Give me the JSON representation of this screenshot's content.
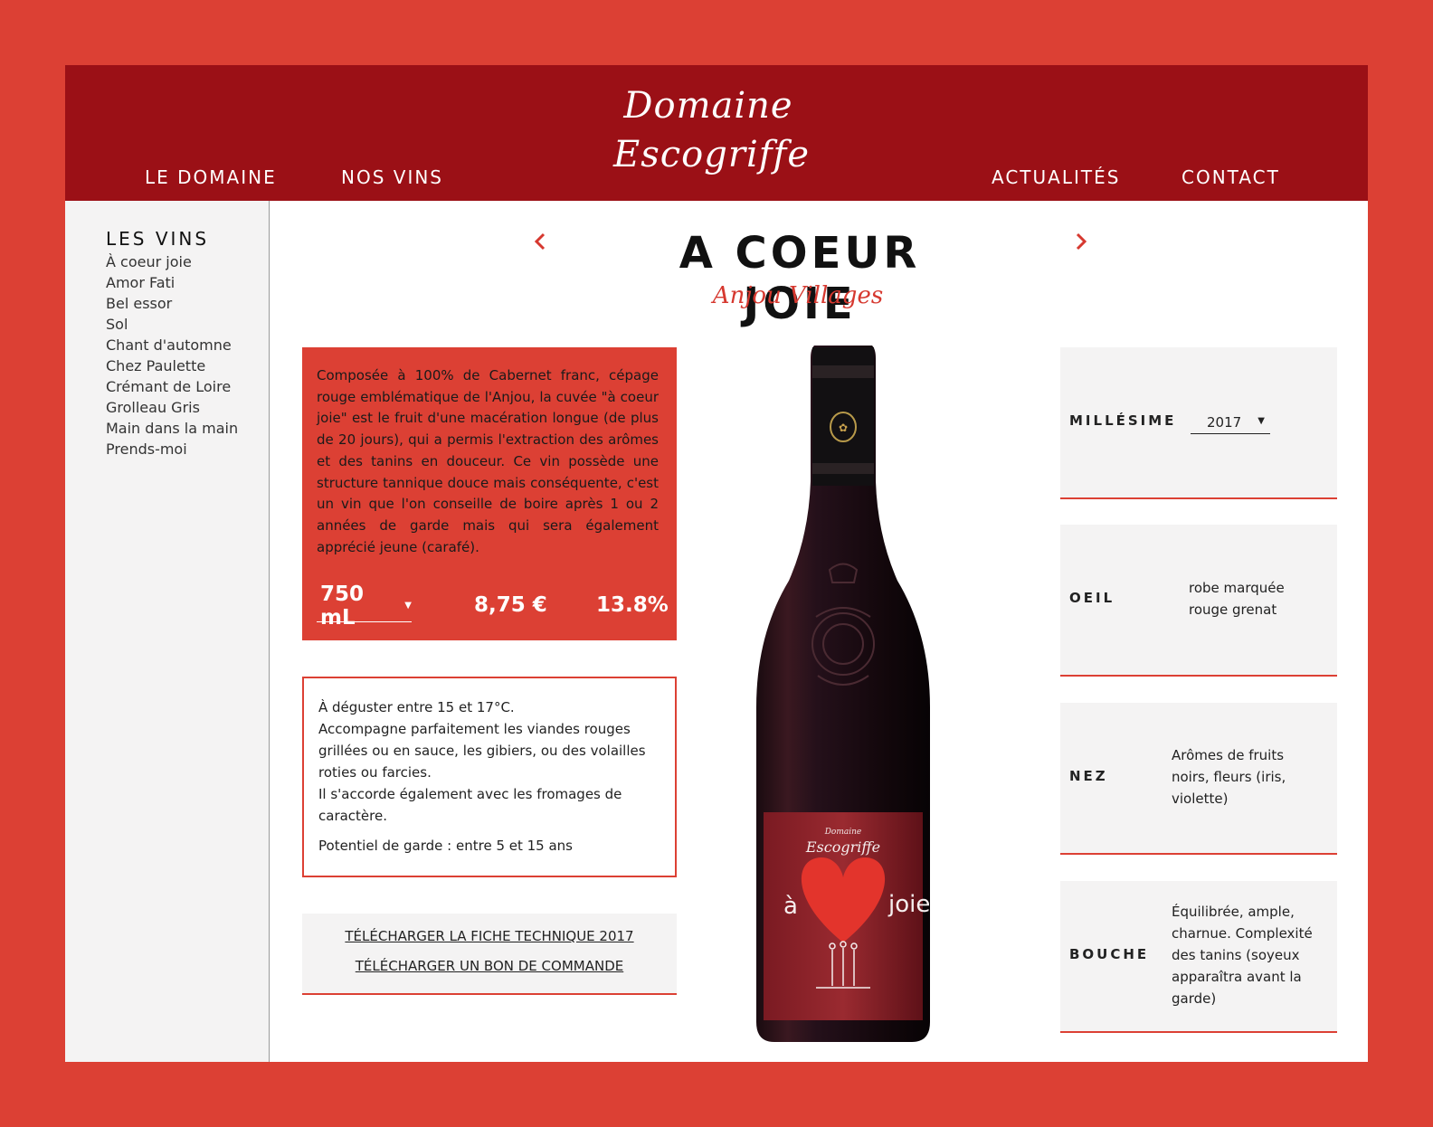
{
  "header": {
    "brand_line1": "Domaine",
    "brand_line2": "Escogriffe",
    "nav": [
      "LE DOMAINE",
      "NOS VINS",
      "ACTUALITÉS",
      "CONTACT"
    ]
  },
  "sidebar": {
    "title": "LES VINS",
    "items": [
      "À coeur joie",
      "Amor Fati",
      "Bel essor",
      "Sol",
      "Chant d'automne",
      "Chez Paulette",
      "Crémant de Loire",
      "Grolleau Gris",
      "Main dans la main",
      "Prends-moi"
    ]
  },
  "wine": {
    "name": "A COEUR JOIE",
    "appellation": "Anjou Villages",
    "description": "Composée à 100% de Cabernet franc, cépage rouge emblématique de l'Anjou, la cuvée \"à coeur joie\" est le fruit d'une macération longue (de plus de 20 jours), qui a permis l'extraction des arômes et des tanins en douceur. Ce vin possède une structure tannique douce mais conséquente, c'est un vin que l'on conseille de boire après 1 ou 2 années de garde mais qui sera également apprécié jeune (carafé).",
    "format": "750 mL",
    "price": "8,75 €",
    "alcohol": "13.8%"
  },
  "serving": {
    "lines": [
      "À déguster entre 15 et 17°C.",
      "Accompagne parfaitement les viandes rouges grillées ou en sauce, les gibiers, ou des volailles roties ou farcies.",
      "Il s'accorde également avec les fromages de caractère."
    ],
    "guard": "Potentiel de garde : entre 5 et 15 ans"
  },
  "downloads": {
    "technical_sheet": "TÉLÉCHARGER LA FICHE TECHNIQUE 2017",
    "order_form": "TÉLÉCHARGER UN BON DE COMMANDE"
  },
  "label": {
    "brand_small": "Domaine",
    "brand": "Escogriffe",
    "word_left": "à",
    "word_right": "joie"
  },
  "cards": {
    "vintage_label": "MILLÉSIME",
    "vintage_value": "2017",
    "eye_label": "OEIL",
    "eye_value_1": "robe marquée",
    "eye_value_2": "rouge grenat",
    "nose_label": "NEZ",
    "nose_value_1": "Arômes de fruits",
    "nose_value_2": "noirs, fleurs (iris,",
    "nose_value_3": "violette)",
    "mouth_label": "BOUCHE",
    "mouth_value_1": "Équilibrée, ample,",
    "mouth_value_2": "charnue. Complexité",
    "mouth_value_3": "des tanins (soyeux",
    "mouth_value_4": "apparaîtra avant la",
    "mouth_value_5": "garde)"
  },
  "colors": {
    "background": "#dc4034",
    "header": "#9b1016",
    "accent": "#d6382f",
    "panel": "#f4f3f3"
  },
  "icons": [
    "chevron-left-icon",
    "chevron-right-icon",
    "caret-down-icon"
  ]
}
